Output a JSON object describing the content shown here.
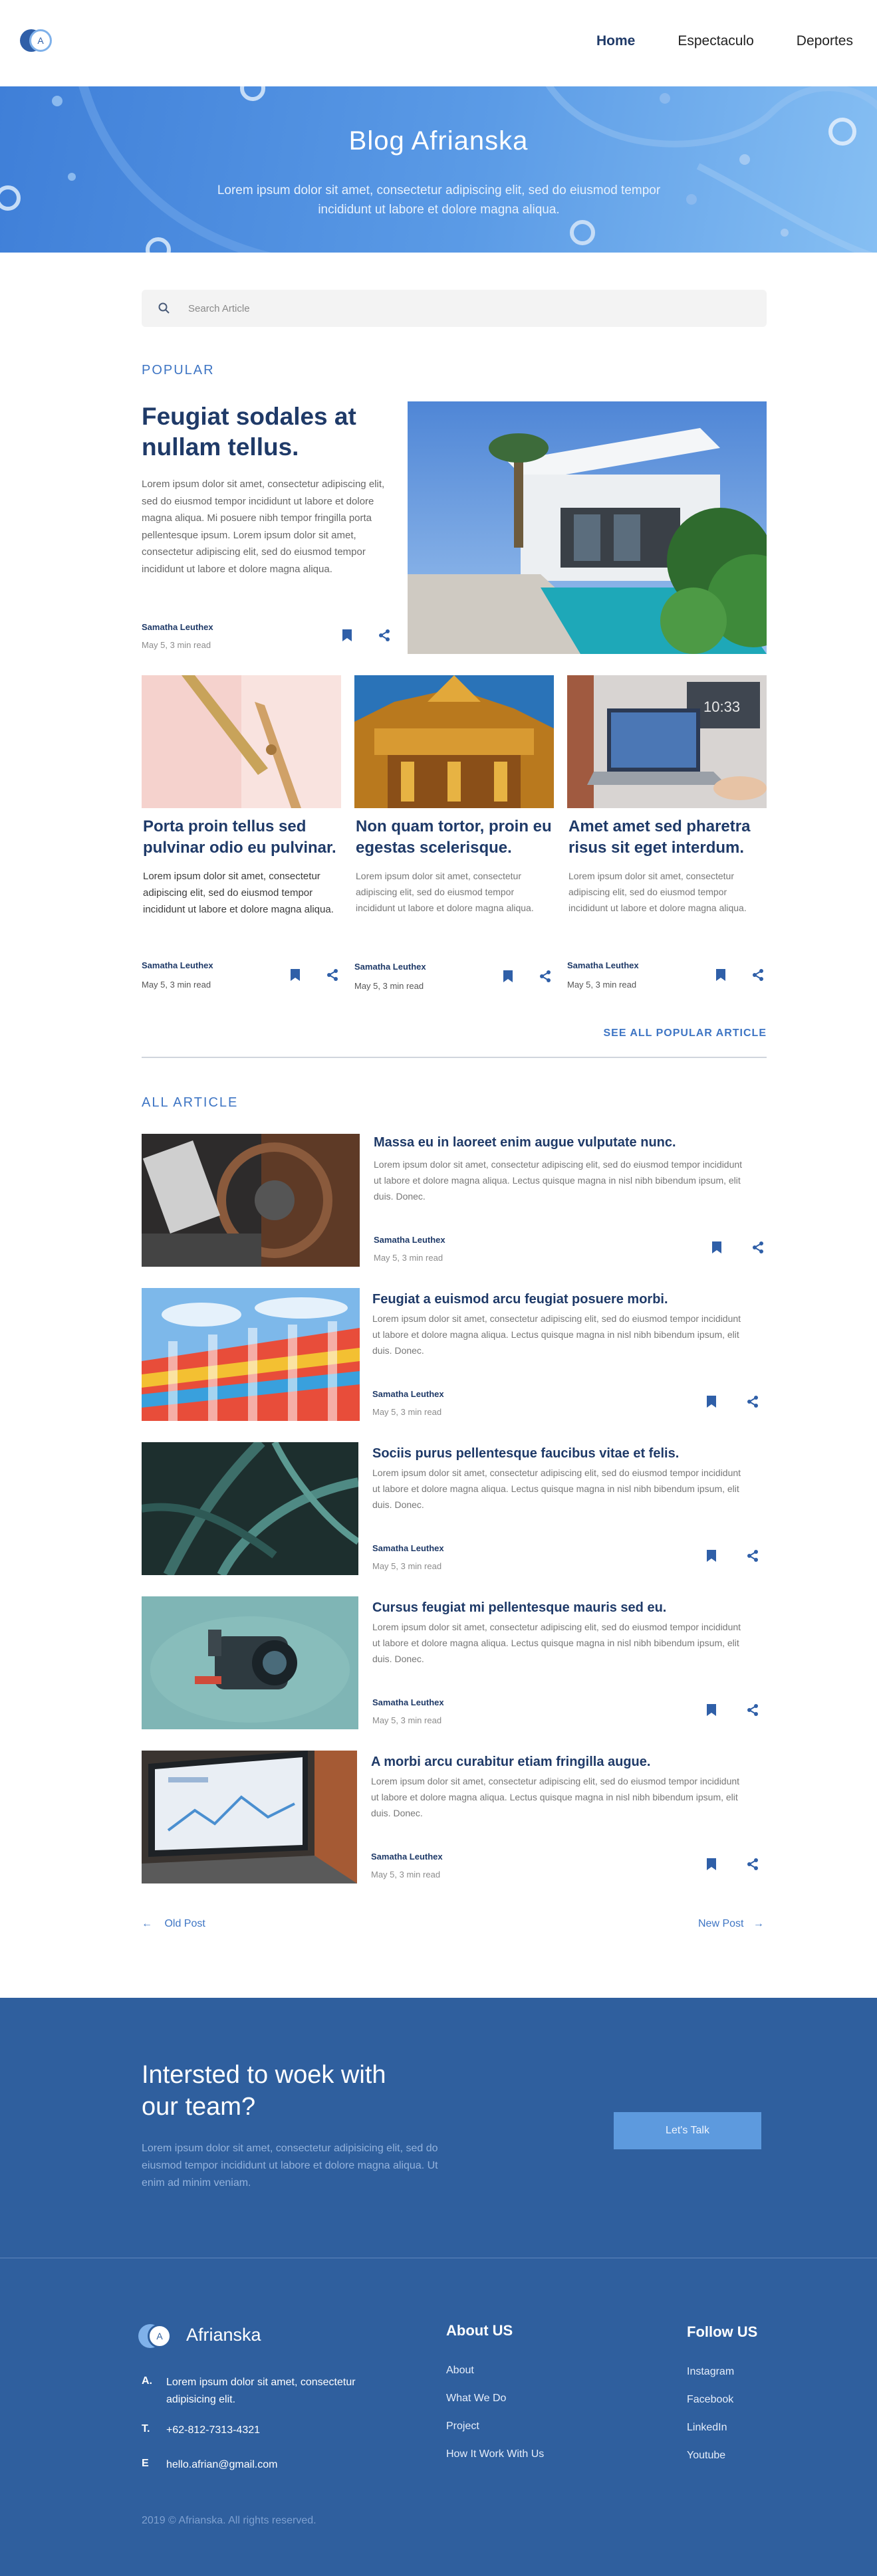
{
  "nav": {
    "logo_letter": "A",
    "links": [
      "Home",
      "Espectaculo",
      "Deportes"
    ]
  },
  "hero": {
    "title": "Blog Afrianska",
    "subtitle": "Lorem ipsum dolor sit amet, consectetur adipiscing elit, sed do eiusmod tempor incididunt ut labore et dolore magna aliqua."
  },
  "search": {
    "placeholder": "Search Article",
    "icon": "search-icon"
  },
  "popular": {
    "label": "POPULAR",
    "featured": {
      "title": "Feugiat sodales at nullam tellus.",
      "body": "Lorem ipsum dolor sit amet, consectetur adipiscing elit, sed do eiusmod tempor incididunt ut labore et dolore magna aliqua. Mi posuere nibh tempor fringilla porta pellentesque ipsum. Lorem ipsum dolor sit amet, consectetur adipiscing elit, sed do eiusmod tempor incididunt ut labore et dolore magna aliqua.",
      "author": "Samatha Leuthex",
      "meta": "May 5, 3 min read"
    },
    "cards": [
      {
        "title": "Porta proin tellus sed pulvinar odio eu pulvinar.",
        "body": "Lorem ipsum dolor sit amet, consectetur adipiscing elit, sed do eiusmod tempor incididunt ut labore et dolore magna aliqua.",
        "author": "Samatha Leuthex",
        "meta": "May 5, 3 min read"
      },
      {
        "title": "Non quam tortor, proin eu egestas scelerisque.",
        "body": "Lorem ipsum dolor sit amet, consectetur adipiscing elit, sed do eiusmod tempor incididunt ut labore et dolore magna aliqua.",
        "author": "Samatha Leuthex",
        "meta": "May 5, 3 min read"
      },
      {
        "title": "Amet amet sed pharetra risus sit eget interdum.",
        "body": "Lorem ipsum dolor sit amet, consectetur adipiscing elit, sed do eiusmod tempor incididunt ut labore et dolore magna aliqua.",
        "author": "Samatha Leuthex",
        "meta": "May 5, 3 min read"
      }
    ],
    "see_all": "SEE ALL POPULAR ARTICLE"
  },
  "all": {
    "label": "ALL ARTICLE",
    "rows": [
      {
        "title": "Massa eu in laoreet enim augue vulputate nunc.",
        "body": "Lorem ipsum dolor sit amet, consectetur adipiscing elit, sed do eiusmod tempor incididunt ut labore et dolore magna aliqua. Lectus quisque magna in nisl nibh bibendum ipsum, elit duis. Donec.",
        "author": "Samatha Leuthex",
        "meta": "May 5, 3 min read"
      },
      {
        "title": "Feugiat a euismod arcu feugiat posuere morbi.",
        "body": "Lorem ipsum dolor sit amet, consectetur adipiscing elit, sed do eiusmod tempor incididunt ut labore et dolore magna aliqua. Lectus quisque magna in nisl nibh bibendum ipsum, elit duis. Donec.",
        "author": "Samatha Leuthex",
        "meta": "May 5, 3 min read"
      },
      {
        "title": "Sociis purus pellentesque faucibus vitae et felis.",
        "body": "Lorem ipsum dolor sit amet, consectetur adipiscing elit, sed do eiusmod tempor incididunt ut labore et dolore magna aliqua. Lectus quisque magna in nisl nibh bibendum ipsum, elit duis. Donec.",
        "author": "Samatha Leuthex",
        "meta": "May 5, 3 min read"
      },
      {
        "title": "Cursus feugiat mi pellentesque mauris sed eu.",
        "body": "Lorem ipsum dolor sit amet, consectetur adipiscing elit, sed do eiusmod tempor incididunt ut labore et dolore magna aliqua. Lectus quisque magna in nisl nibh bibendum ipsum, elit duis. Donec.",
        "author": "Samatha Leuthex",
        "meta": "May 5, 3 min read"
      },
      {
        "title": "A morbi arcu curabitur etiam fringilla augue.",
        "body": "Lorem ipsum dolor sit amet, consectetur adipiscing elit, sed do eiusmod tempor incididunt ut labore et dolore magna aliqua. Lectus quisque magna in nisl nibh bibendum ipsum, elit duis. Donec.",
        "author": "Samatha Leuthex",
        "meta": "May 5, 3 min read"
      }
    ],
    "old_post": "Old Post",
    "new_post": "New Post"
  },
  "cta": {
    "title": "Intersted to woek with our team?",
    "body": "Lorem ipsum dolor sit amet, consectetur adipisicing elit, sed do eiusmod tempor incididunt ut labore et dolore magna aliqua. Ut enim ad minim veniam.",
    "button": "Let's Talk"
  },
  "footer": {
    "brand": "Afrianska",
    "logo_letter": "A",
    "contact": [
      {
        "key": "A.",
        "value": "Lorem ipsum dolor sit amet, consectetur adipisicing elit."
      },
      {
        "key": "T.",
        "value": "+62-812-7313-4321"
      },
      {
        "key": "E",
        "value": "hello.afrian@gmail.com"
      }
    ],
    "about_title": "About US",
    "about_links": [
      "About",
      "What We Do",
      "Project",
      "How It Work With Us"
    ],
    "follow_title": "Follow US",
    "follow_links": [
      "Instagram",
      "Facebook",
      "LinkedIn",
      "Youtube"
    ],
    "copyright": "2019 © Afrianska. All rights reserved."
  },
  "colors": {
    "primary": "#1f3a68",
    "accent": "#3e75c4",
    "footer_bg": "#2f5f9e",
    "button": "#5d9ade"
  }
}
